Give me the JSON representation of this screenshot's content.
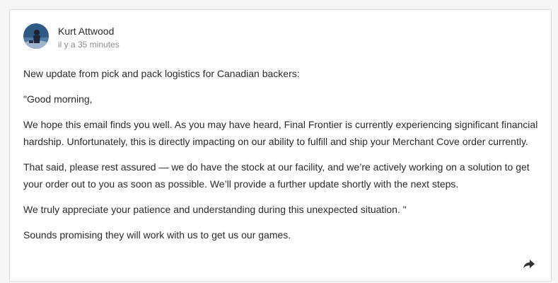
{
  "post": {
    "author": "Kurt Attwood",
    "timestamp": "il y a 35 minutes",
    "avatar_icon": "user-avatar-photo",
    "paragraphs": [
      "New update from pick and pack logistics for Canadian backers:",
      "\"Good morning,",
      "We hope this email finds you well. As you may have heard, Final Frontier is currently experiencing significant financial hardship. Unfortunately, this is directly impacting on our ability to fulfill and ship your Merchant Cove order currently.",
      "That said, please rest assured — we do have the stock at our facility, and we’re actively working on a solution to get your order out to you as soon as possible. We’ll provide a further update shortly with the next steps.",
      "We truly appreciate your patience and understanding during this unexpected situation. \"",
      "Sounds promising they will work with us to get us our games."
    ],
    "share_icon": "share-arrow-icon"
  },
  "colors": {
    "text": "#2b2b2b",
    "muted": "#8f8f8f",
    "border": "#dedede"
  }
}
